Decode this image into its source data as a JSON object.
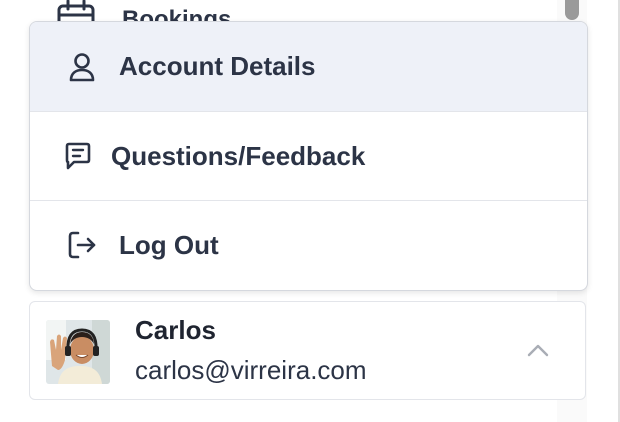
{
  "background": {
    "nav_item_label": "Bookings",
    "nav_item_icon": "calendar-icon"
  },
  "menu": {
    "items": [
      {
        "label": "Account Details",
        "icon": "user-icon",
        "active": true
      },
      {
        "label": "Questions/Feedback",
        "icon": "message-icon",
        "active": false
      },
      {
        "label": "Log Out",
        "icon": "logout-icon",
        "active": false
      }
    ]
  },
  "user": {
    "name": "Carlos",
    "email": "carlos@virreira.com",
    "toggle_icon": "chevron-up-icon"
  },
  "colors": {
    "text": "#2c3446",
    "active_item_bg": "#eef1f8",
    "border": "#d5d8de"
  }
}
